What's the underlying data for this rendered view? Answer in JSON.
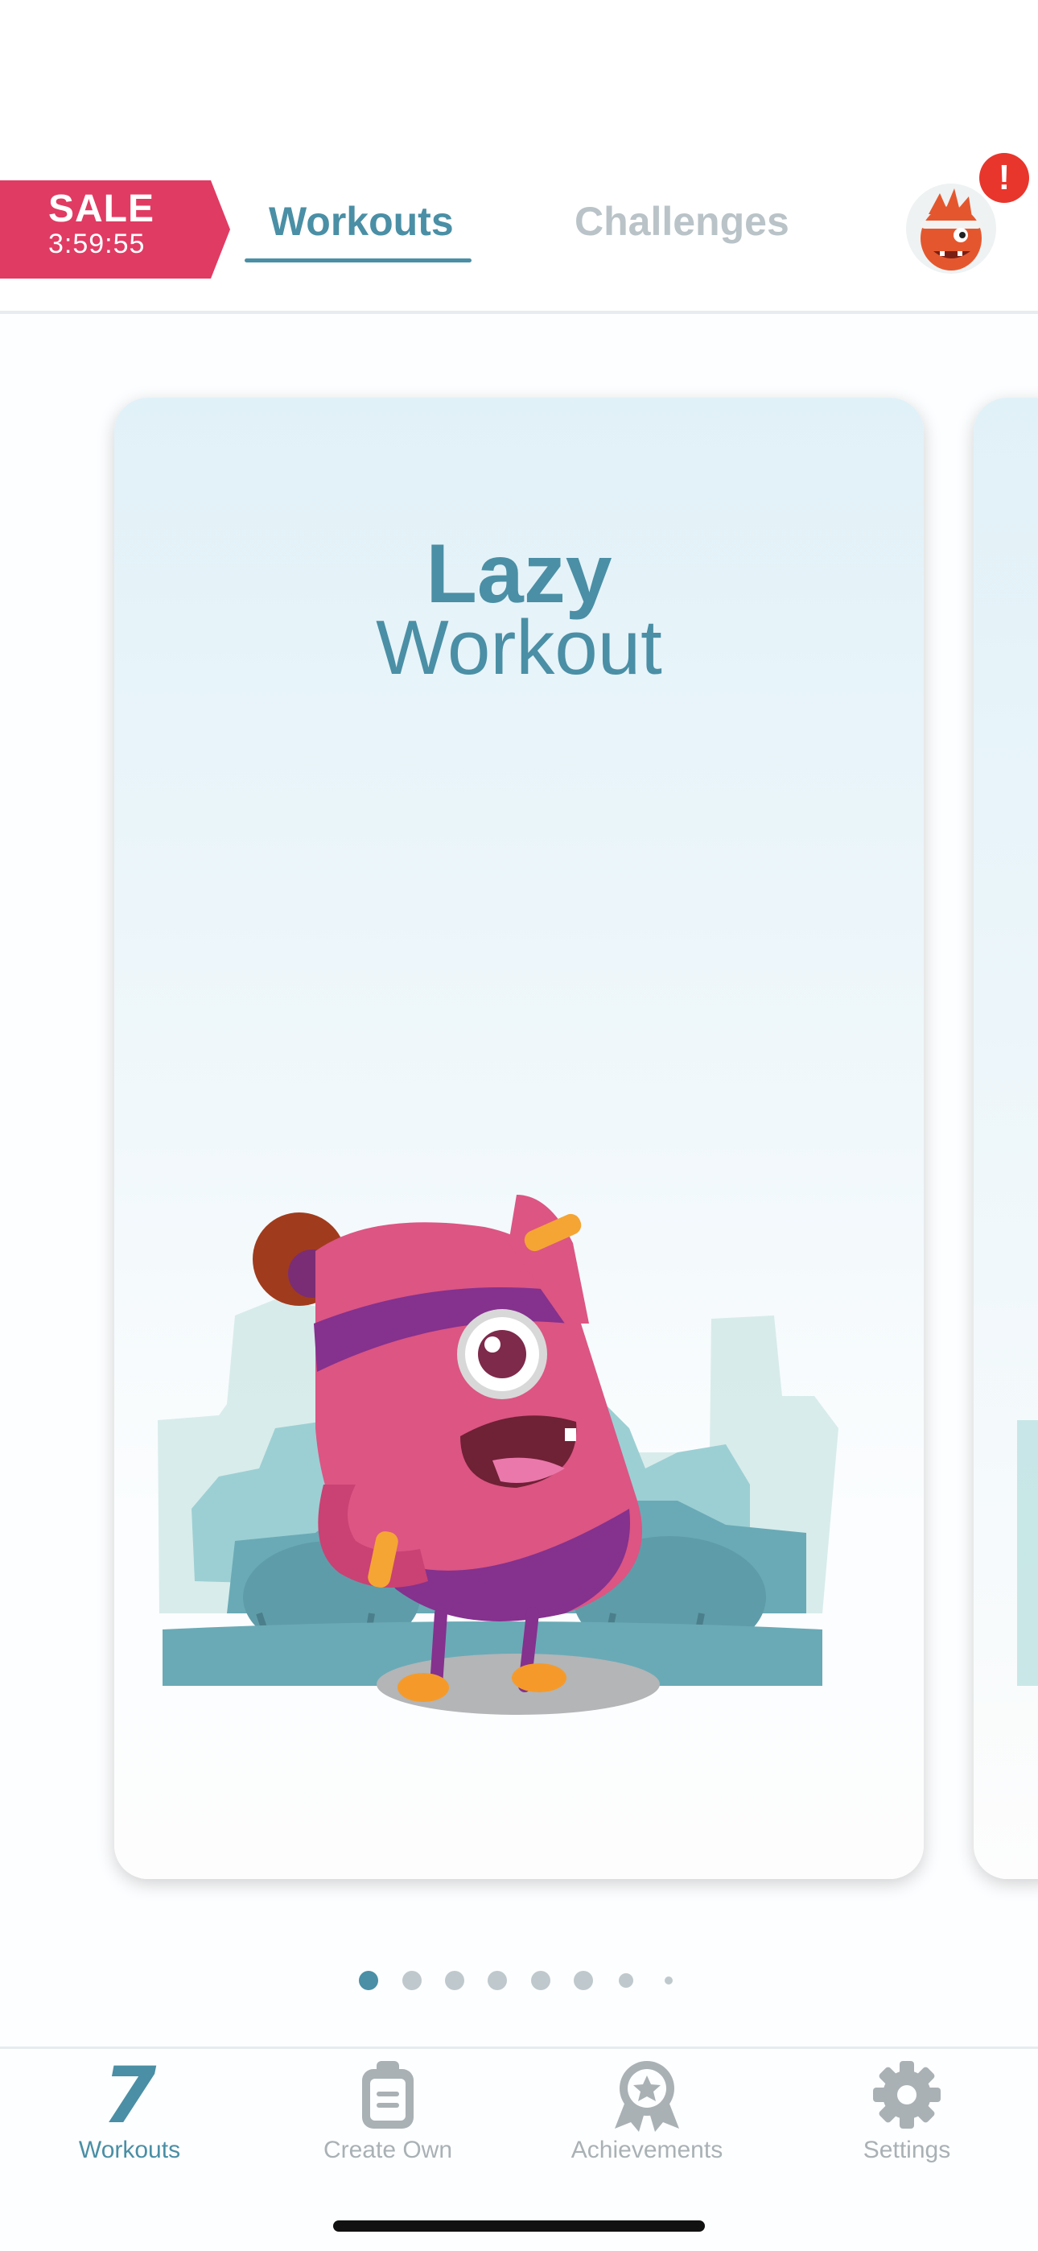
{
  "header": {
    "sale": {
      "title": "SALE",
      "timer": "3:59:55"
    },
    "tabs": [
      {
        "label": "Workouts",
        "active": true
      },
      {
        "label": "Challenges",
        "active": false
      }
    ],
    "alert_badge": "!",
    "avatar_icon": "monster-avatar-icon"
  },
  "carousel": {
    "current_card": {
      "title_line1": "Lazy",
      "title_line2": "Workout",
      "illustration": "pink-monster-workout-illustration"
    },
    "pages": 8,
    "active_page": 1
  },
  "tabbar": {
    "items": [
      {
        "label": "Workouts",
        "icon": "seven-minute-icon",
        "glyph": "7",
        "active": true
      },
      {
        "label": "Create Own",
        "icon": "clipboard-icon",
        "active": false
      },
      {
        "label": "Achievements",
        "icon": "award-ribbon-icon",
        "active": false
      },
      {
        "label": "Settings",
        "icon": "gear-icon",
        "active": false
      }
    ]
  },
  "colors": {
    "accent": "#4a8fa5",
    "sale": "#e03b63",
    "alert": "#e8362d",
    "inactive": "#b9c3c8"
  }
}
